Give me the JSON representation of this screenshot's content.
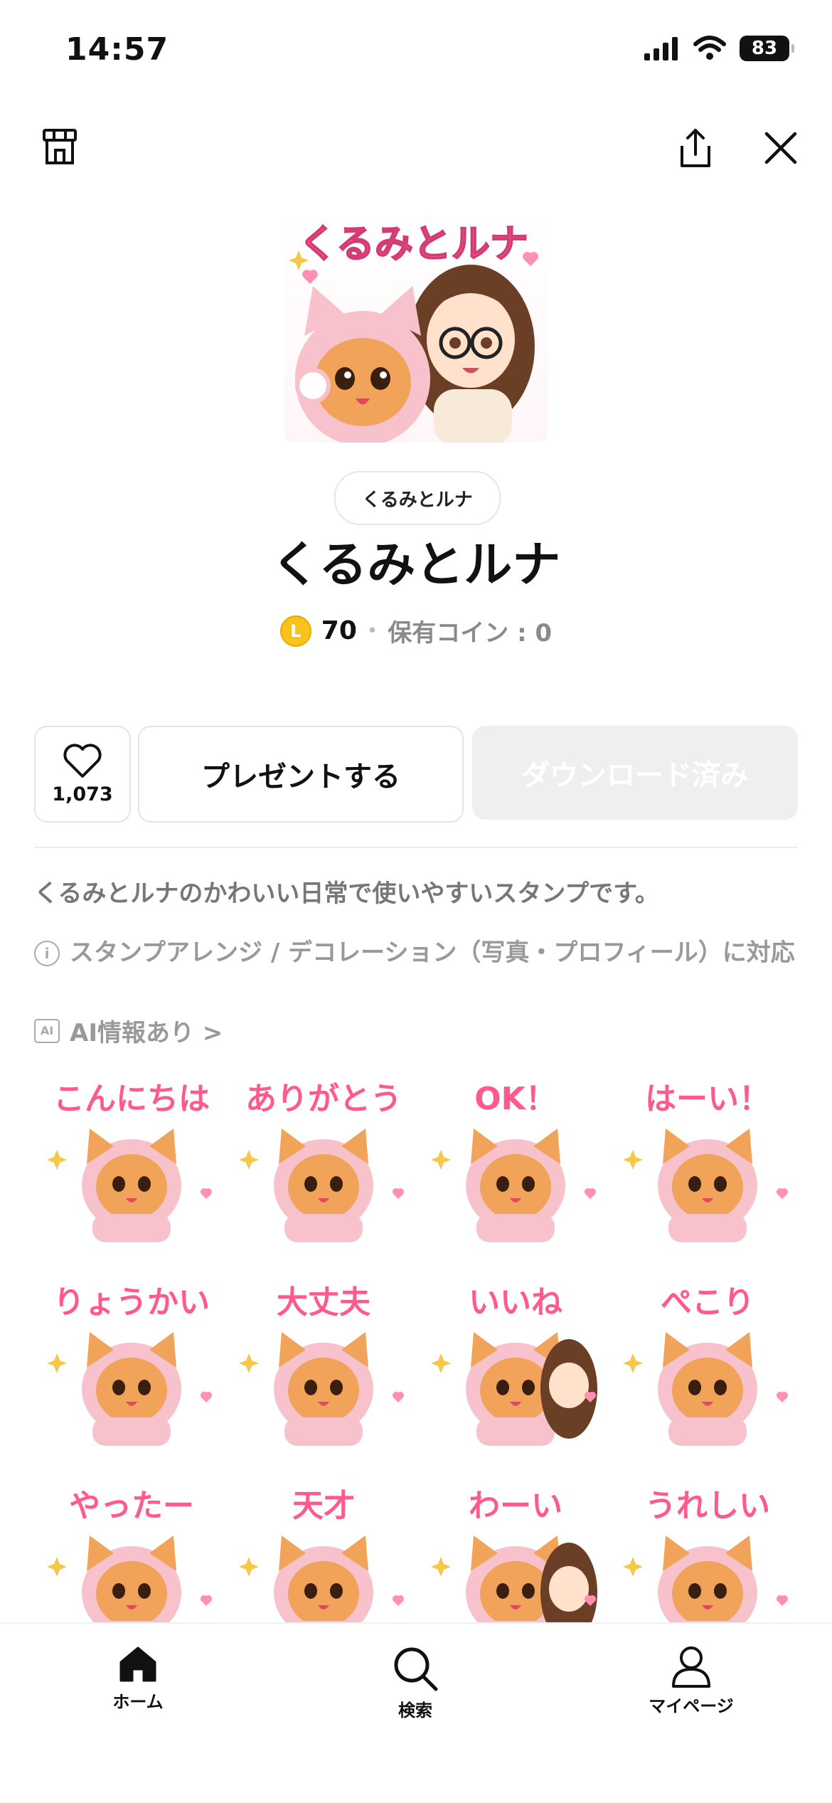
{
  "status_bar": {
    "time": "14:57",
    "battery": "83"
  },
  "header": {
    "shop_icon": "store-icon",
    "share_icon": "share-icon",
    "close_icon": "close-icon"
  },
  "hero": {
    "title": "くるみとルナ"
  },
  "author": {
    "label": "くるみとルナ"
  },
  "pack": {
    "title": "くるみとルナ",
    "coin_symbol": "L",
    "price": "70",
    "separator": "•",
    "owned_label": "保有コイン : 0"
  },
  "actions": {
    "like_count": "1,073",
    "present_label": "プレゼントする",
    "download_label": "ダウンロード済み"
  },
  "description": "くるみとルナのかわいい日常で使いやすいスタンプです。",
  "info": {
    "icon": "i",
    "text": "スタンプアレンジ / デコレーション（写真・プロフィール）に対応"
  },
  "ai": {
    "badge": "AI",
    "text": "AI情報あり >"
  },
  "stickers": [
    {
      "label": "こんにちは"
    },
    {
      "label": "ありがとう"
    },
    {
      "label": "OK！"
    },
    {
      "label": "はーい！"
    },
    {
      "label": "りょうかい"
    },
    {
      "label": "大丈夫"
    },
    {
      "label": "いいね"
    },
    {
      "label": "ぺこり"
    },
    {
      "label": "やったー"
    },
    {
      "label": "天才"
    },
    {
      "label": "わーい"
    },
    {
      "label": "うれしい"
    }
  ],
  "tabs": [
    {
      "label": "ホーム",
      "icon": "home-icon"
    },
    {
      "label": "検索",
      "icon": "search-icon"
    },
    {
      "label": "マイページ",
      "icon": "person-icon"
    }
  ],
  "colors": {
    "accent_pink": "#ff5a8e",
    "coin": "#f8c31a",
    "muted": "#999999"
  }
}
